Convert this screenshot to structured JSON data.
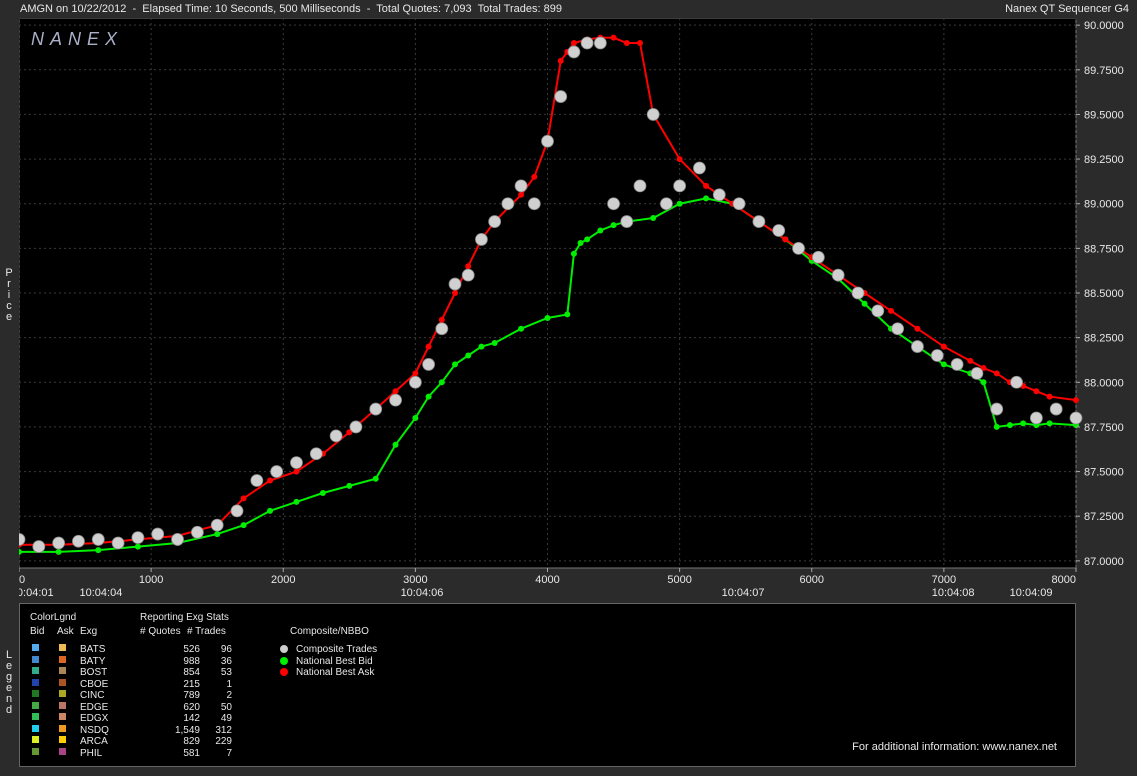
{
  "window": {
    "title_left": "AMGN on 10/22/2012  -  Elapsed Time: 10 Seconds, 500 Milliseconds  -  Total Quotes: 7,093  Total Trades: 899",
    "title_right": "Nanex QT Sequencer G4",
    "side_price": "Price",
    "side_legend": "Legend"
  },
  "chart_data": {
    "type": "line",
    "watermark": "NANEX",
    "background": "#000000",
    "grid": true,
    "x_ticks": [
      0,
      1000,
      2000,
      3000,
      4000,
      5000,
      6000,
      7000,
      8000
    ],
    "x_tick_labels": [
      "0",
      "1000",
      "2000",
      "3000",
      "4000",
      "5000",
      "6000",
      "7000",
      "8000"
    ],
    "xlim": [
      0,
      8000
    ],
    "y_ticks": [
      87.0,
      87.25,
      87.5,
      87.75,
      88.0,
      88.25,
      88.5,
      88.75,
      89.0,
      89.25,
      89.5,
      89.75,
      90.0
    ],
    "y_tick_labels": [
      "87.0000",
      "87.2500",
      "87.5000",
      "87.7500",
      "88.0000",
      "88.2500",
      "88.5000",
      "88.7500",
      "89.0000",
      "89.2500",
      "89.5000",
      "89.7500",
      "90.0000"
    ],
    "ylim": [
      86.96,
      90.04
    ],
    "time_labels": [
      {
        "x": 100,
        "label": "10:04:01"
      },
      {
        "x": 620,
        "label": "10:04:04"
      },
      {
        "x": 3050,
        "label": "10:04:06"
      },
      {
        "x": 5480,
        "label": "10:04:07"
      },
      {
        "x": 7070,
        "label": "10:04:08"
      },
      {
        "x": 7660,
        "label": "10:04:09"
      }
    ],
    "series": [
      {
        "name": "National Best Bid",
        "color": "#00ee00",
        "x": [
          0,
          300,
          600,
          900,
          1200,
          1500,
          1700,
          1900,
          2100,
          2300,
          2500,
          2700,
          2850,
          3000,
          3100,
          3200,
          3300,
          3400,
          3500,
          3600,
          3800,
          4000,
          4150,
          4200,
          4250,
          4300,
          4400,
          4500,
          4600,
          4800,
          5000,
          5200,
          5400,
          5600,
          5800,
          6000,
          6200,
          6400,
          6600,
          6800,
          7000,
          7200,
          7300,
          7400,
          7500,
          7600,
          7700,
          7800,
          8000
        ],
        "y": [
          87.05,
          87.05,
          87.06,
          87.08,
          87.1,
          87.15,
          87.2,
          87.28,
          87.33,
          87.38,
          87.42,
          87.46,
          87.65,
          87.8,
          87.92,
          88.0,
          88.1,
          88.15,
          88.2,
          88.22,
          88.3,
          88.36,
          88.38,
          88.72,
          88.78,
          88.8,
          88.85,
          88.88,
          88.9,
          88.92,
          89.0,
          89.03,
          89.0,
          88.9,
          88.8,
          88.68,
          88.58,
          88.44,
          88.3,
          88.2,
          88.1,
          88.05,
          88.0,
          87.75,
          87.76,
          87.77,
          87.76,
          87.77,
          87.76
        ]
      },
      {
        "name": "National Best Ask",
        "color": "#ff0000",
        "x": [
          0,
          300,
          600,
          900,
          1200,
          1500,
          1700,
          1900,
          2100,
          2300,
          2500,
          2700,
          2850,
          3000,
          3100,
          3200,
          3300,
          3400,
          3500,
          3600,
          3800,
          3900,
          4000,
          4100,
          4150,
          4200,
          4300,
          4400,
          4500,
          4600,
          4700,
          4800,
          5000,
          5200,
          5400,
          5600,
          5800,
          6000,
          6200,
          6400,
          6600,
          6800,
          7000,
          7200,
          7300,
          7400,
          7500,
          7600,
          7700,
          7800,
          8000
        ],
        "y": [
          87.09,
          87.09,
          87.1,
          87.12,
          87.14,
          87.2,
          87.35,
          87.45,
          87.5,
          87.6,
          87.72,
          87.85,
          87.95,
          88.05,
          88.2,
          88.35,
          88.5,
          88.65,
          88.8,
          88.9,
          89.05,
          89.15,
          89.35,
          89.8,
          89.85,
          89.9,
          89.92,
          89.93,
          89.93,
          89.9,
          89.9,
          89.5,
          89.25,
          89.1,
          89.0,
          88.9,
          88.8,
          88.7,
          88.6,
          88.5,
          88.4,
          88.3,
          88.2,
          88.12,
          88.08,
          88.05,
          88.0,
          87.98,
          87.95,
          87.92,
          87.9
        ]
      },
      {
        "name": "Composite Trades",
        "color": "#d0d0d0",
        "x": [
          0,
          150,
          300,
          450,
          600,
          750,
          900,
          1050,
          1200,
          1350,
          1500,
          1650,
          1800,
          1950,
          2100,
          2250,
          2400,
          2550,
          2700,
          2850,
          3000,
          3100,
          3200,
          3300,
          3400,
          3500,
          3600,
          3700,
          3800,
          3900,
          4000,
          4100,
          4200,
          4300,
          4400,
          4500,
          4600,
          4700,
          4800,
          4900,
          5000,
          5150,
          5300,
          5450,
          5600,
          5750,
          5900,
          6050,
          6200,
          6350,
          6500,
          6650,
          6800,
          6950,
          7100,
          7250,
          7400,
          7550,
          7700,
          7850,
          8000
        ],
        "y": [
          87.12,
          87.08,
          87.1,
          87.11,
          87.12,
          87.1,
          87.13,
          87.15,
          87.12,
          87.16,
          87.2,
          87.28,
          87.45,
          87.5,
          87.55,
          87.6,
          87.7,
          87.75,
          87.85,
          87.9,
          88.0,
          88.1,
          88.3,
          88.55,
          88.6,
          88.8,
          88.9,
          89.0,
          89.1,
          89.0,
          89.35,
          89.6,
          89.85,
          89.9,
          89.9,
          89.0,
          88.9,
          89.1,
          89.5,
          89.0,
          89.1,
          89.2,
          89.05,
          89.0,
          88.9,
          88.85,
          88.75,
          88.7,
          88.6,
          88.5,
          88.4,
          88.3,
          88.2,
          88.15,
          88.1,
          88.05,
          87.85,
          88.0,
          87.8,
          87.85,
          87.8
        ]
      }
    ]
  },
  "legend": {
    "hdr_colorlgnd": "ColorLgnd",
    "hdr_bid": "Bid",
    "hdr_ask": "Ask",
    "hdr_exg": "Exg",
    "hdr_reporting": "Reporting Exg Stats",
    "hdr_quotes": "# Quotes",
    "hdr_trades": "# Trades",
    "hdr_composite": "Composite/NBBO",
    "exchanges": [
      {
        "exg": "BATS",
        "quotes": "526",
        "trades": "96",
        "bid_color": "#55aaee",
        "ask_color": "#eebb55"
      },
      {
        "exg": "BATY",
        "quotes": "988",
        "trades": "36",
        "bid_color": "#4488cc",
        "ask_color": "#dd6622"
      },
      {
        "exg": "BOST",
        "quotes": "854",
        "trades": "53",
        "bid_color": "#33aa88",
        "ask_color": "#aa8855"
      },
      {
        "exg": "CBOE",
        "quotes": "215",
        "trades": "1",
        "bid_color": "#2244aa",
        "ask_color": "#aa5522"
      },
      {
        "exg": "CINC",
        "quotes": "789",
        "trades": "2",
        "bid_color": "#227722",
        "ask_color": "#aaaa22"
      },
      {
        "exg": "EDGE",
        "quotes": "620",
        "trades": "50",
        "bid_color": "#44aa44",
        "ask_color": "#bb7766"
      },
      {
        "exg": "EDGX",
        "quotes": "142",
        "trades": "49",
        "bid_color": "#33bb55",
        "ask_color": "#cc8866"
      },
      {
        "exg": "NSDQ",
        "quotes": "1,549",
        "trades": "312",
        "bid_color": "#22ccee",
        "ask_color": "#ee9922"
      },
      {
        "exg": "ARCA",
        "quotes": "829",
        "trades": "229",
        "bid_color": "#ddee22",
        "ask_color": "#ffcc00"
      },
      {
        "exg": "PHIL",
        "quotes": "581",
        "trades": "7",
        "bid_color": "#669933",
        "ask_color": "#aa4488"
      }
    ],
    "composite": [
      {
        "label": "Composite Trades",
        "color": "#cccccc"
      },
      {
        "label": "National Best Bid",
        "color": "#00ee00"
      },
      {
        "label": "National Best Ask",
        "color": "#ff0000"
      }
    ]
  },
  "footer": "For additional information: www.nanex.net"
}
